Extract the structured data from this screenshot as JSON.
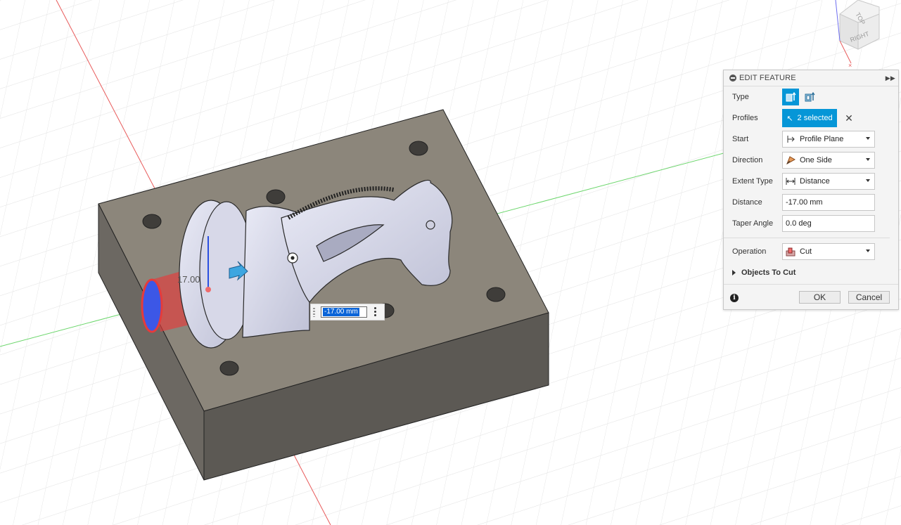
{
  "edit_feature": {
    "title": "EDIT FEATURE",
    "type_label": "Type",
    "profiles_label": "Profiles",
    "profiles_value": "2 selected",
    "start_label": "Start",
    "start_value": "Profile Plane",
    "direction_label": "Direction",
    "direction_value": "One Side",
    "extent_label": "Extent Type",
    "extent_value": "Distance",
    "distance_label": "Distance",
    "distance_value": "-17.00 mm",
    "taper_label": "Taper Angle",
    "taper_value": "0.0 deg",
    "operation_label": "Operation",
    "operation_value": "Cut",
    "objects_to_cut": "Objects To Cut",
    "ok": "OK",
    "cancel": "Cancel"
  },
  "inline_distance": {
    "value": "-17.00 mm"
  },
  "dimension_label": "17.00",
  "viewcube": {
    "top": "TOP",
    "right": "RIGHT"
  },
  "colors": {
    "accent": "#0696d7",
    "block_top": "#8b8478",
    "block_side": "#6e6a62",
    "block_front": "#5f5b55",
    "cut_red": "#e53b3b",
    "axis_red": "#e85a5a",
    "axis_green": "#6cd66c"
  }
}
